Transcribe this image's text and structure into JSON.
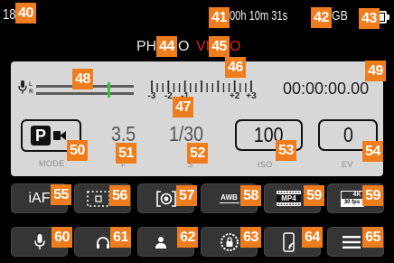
{
  "colors": {
    "background": "#000000",
    "annotation": "#f07d1d",
    "video_mode": "#e3241b",
    "audio_peak": "#3cc43c",
    "panel": "#d7d7d7"
  },
  "status_bar": {
    "left_value": "18",
    "recording_time": "00h 10m 31s",
    "storage_unit": "GB",
    "battery_icon": "battery-icon",
    "battery_level": 1
  },
  "mode_switch": {
    "photo": {
      "prefix": "PH",
      "suffix": "O"
    },
    "video": {
      "prefix": "VI",
      "suffix": "O",
      "selected": true
    }
  },
  "info_panel": {
    "audio": {
      "icon": "microphone-icon",
      "left_channel": "L",
      "right_channel": "R",
      "peak_level": 0.74
    },
    "exposure_scale": {
      "min": -3,
      "max": 3,
      "ticks_per_stop": 3,
      "labels": [
        {
          "value": -3,
          "text": "-3"
        },
        {
          "value": -2,
          "text": "-2"
        },
        {
          "value": -1,
          "text": "-1"
        },
        {
          "value": 2,
          "text": "+2"
        },
        {
          "value": 3,
          "text": "+3"
        }
      ]
    },
    "timecode": "00:00:00.00",
    "mode": {
      "value": "P",
      "icon": "video-camera-icon",
      "label": "MODE"
    },
    "aperture": {
      "value": "3.5",
      "label": "F"
    },
    "shutter": {
      "value": "1/30",
      "label": "S"
    },
    "iso": {
      "value": "100",
      "label": "ISO"
    },
    "exposure_compensation": {
      "value": "0",
      "label": "EV"
    }
  },
  "quick_buttons": {
    "row1": [
      {
        "text": "iAF"
      },
      {
        "icon": "focus-area-icon"
      },
      {
        "icon": "metering-icon"
      },
      {
        "text": "AWB",
        "icon": "white-balance-icon"
      },
      {
        "text": "MP4",
        "icon": "file-format-icon"
      },
      {
        "text": "4K",
        "subtext": "30 fps",
        "icon": "video-resolution-icon"
      }
    ],
    "row2": [
      {
        "icon": "microphone-icon"
      },
      {
        "icon": "headphones-icon"
      },
      {
        "icon": "user-profile-icon"
      },
      {
        "icon": "settings-lock-icon"
      },
      {
        "icon": "smartphone-wifi-icon"
      },
      {
        "icon": "menu-icon"
      }
    ]
  },
  "annotations": [
    "40",
    "41",
    "42",
    "43",
    "44",
    "45",
    "46",
    "47",
    "48",
    "49",
    "50",
    "51",
    "52",
    "53",
    "54",
    "55",
    "56",
    "57",
    "58",
    "59",
    "59",
    "60",
    "61",
    "62",
    "63",
    "64",
    "65"
  ]
}
